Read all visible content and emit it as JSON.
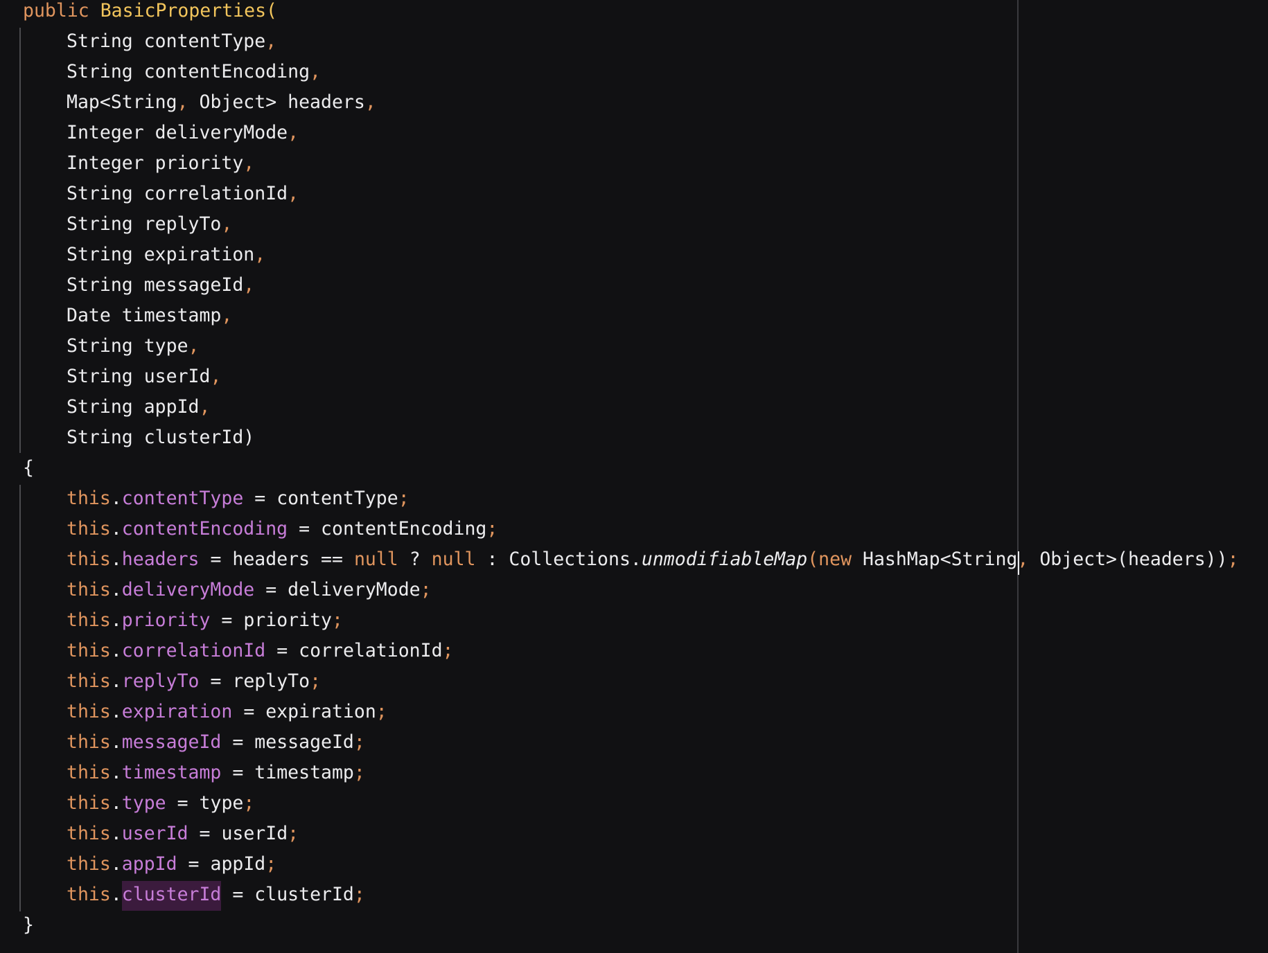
{
  "signature": {
    "modifier": "public",
    "name": "BasicProperties",
    "open_paren": "(",
    "close_paren": ")"
  },
  "parameters": [
    {
      "type": "String",
      "name": "contentType",
      "sep": ","
    },
    {
      "type": "String",
      "name": "contentEncoding",
      "sep": ","
    },
    {
      "type": "Map<String",
      "type2": "Object>",
      "name": "headers",
      "sep": ","
    },
    {
      "type": "Integer",
      "name": "deliveryMode",
      "sep": ","
    },
    {
      "type": "Integer",
      "name": "priority",
      "sep": ","
    },
    {
      "type": "String",
      "name": "correlationId",
      "sep": ","
    },
    {
      "type": "String",
      "name": "replyTo",
      "sep": ","
    },
    {
      "type": "String",
      "name": "expiration",
      "sep": ","
    },
    {
      "type": "String",
      "name": "messageId",
      "sep": ","
    },
    {
      "type": "Date",
      "name": "timestamp",
      "sep": ","
    },
    {
      "type": "String",
      "name": "type",
      "sep": ","
    },
    {
      "type": "String",
      "name": "userId",
      "sep": ","
    },
    {
      "type": "String",
      "name": "appId",
      "sep": ","
    },
    {
      "type": "String",
      "name": "clusterId",
      "sep": ""
    }
  ],
  "braces": {
    "open": "{",
    "close": "}"
  },
  "body": {
    "this_kw": "this",
    "dot": ".",
    "assign": "=",
    "semicolon": ";",
    "comma": ",",
    "assignments": [
      {
        "field": "contentType",
        "value": "contentType"
      },
      {
        "field": "contentEncoding",
        "value": "contentEncoding"
      },
      {
        "field": "headers",
        "value": "headers"
      },
      {
        "field": "deliveryMode",
        "value": "deliveryMode"
      },
      {
        "field": "priority",
        "value": "priority"
      },
      {
        "field": "correlationId",
        "value": "correlationId"
      },
      {
        "field": "replyTo",
        "value": "replyTo"
      },
      {
        "field": "expiration",
        "value": "expiration"
      },
      {
        "field": "messageId",
        "value": "messageId"
      },
      {
        "field": "timestamp",
        "value": "timestamp"
      },
      {
        "field": "type",
        "value": "type"
      },
      {
        "field": "userId",
        "value": "userId"
      },
      {
        "field": "appId",
        "value": "appId"
      },
      {
        "field": "clusterId",
        "value": "clusterId"
      }
    ],
    "headers_expr": {
      "eq": "==",
      "null1": "null",
      "question": "?",
      "null2": "null",
      "colon": ":",
      "collections": "Collections",
      "method": "unmodifiableMap",
      "open_paren": "(",
      "new_kw": "new",
      "hashmap": "HashMap<String",
      "object": "Object>(headers))"
    }
  },
  "colors": {
    "background": "#111113",
    "keyword": "#e0955e",
    "function_name": "#f2c55c",
    "field": "#c77dd8",
    "plain": "#ececee",
    "selection_highlight": "#3b1b3d"
  }
}
